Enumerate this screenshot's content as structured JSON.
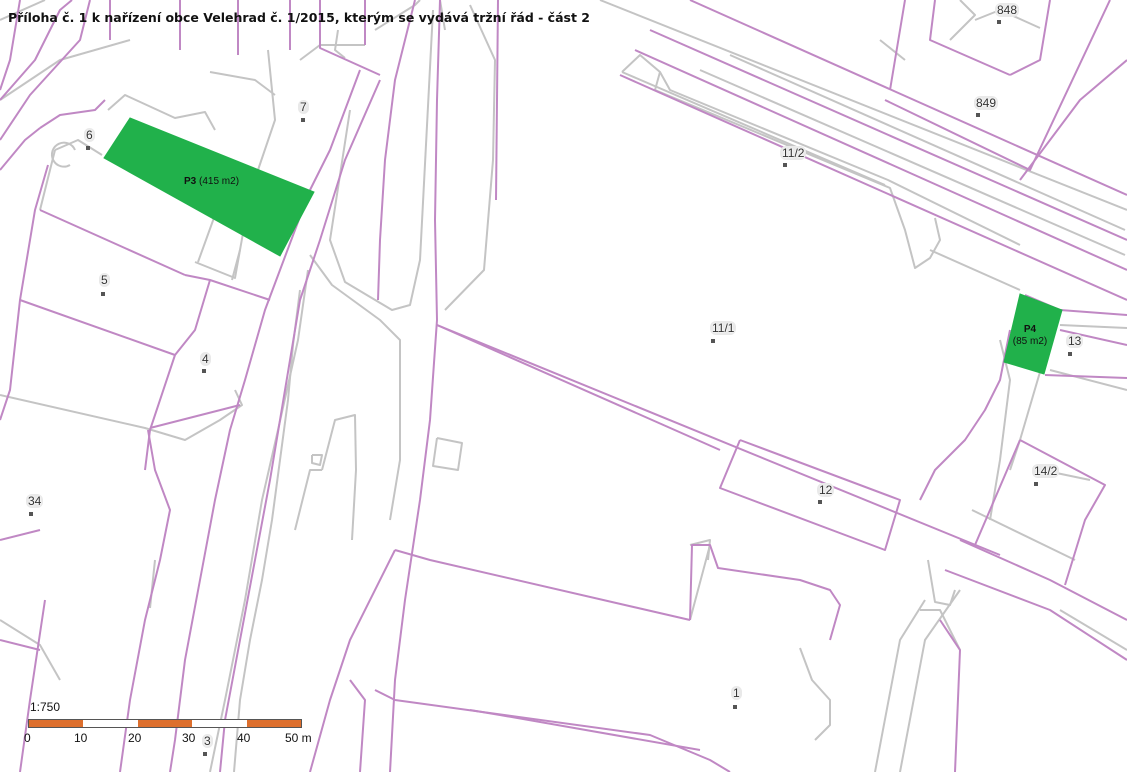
{
  "title": "Příloha č. 1 k nařízení obce Velehrad č. 1/2015, kterým se vydává tržní řád - část 2",
  "zones": {
    "p3": {
      "id": "P3",
      "area": "(415 m2)"
    },
    "p4": {
      "id": "P4",
      "area": "(85 m2)"
    }
  },
  "parcels": {
    "p848": "848",
    "p849": "849",
    "p7": "7",
    "p6": "6",
    "p11_2": "11/2",
    "p5": "5",
    "p11_1": "11/1",
    "p13": "13",
    "p4": "4",
    "p14_2": "14/2",
    "p34": "34",
    "p12": "12",
    "p1": "1",
    "p3": "3"
  },
  "scale": {
    "ratio": "1:750",
    "ticks": [
      "0",
      "10",
      "20",
      "30",
      "40",
      "50 m"
    ]
  },
  "colors": {
    "zone_fill": "#21b14b",
    "cadastral_line": "#c088c4",
    "building_line": "#c4c4c4",
    "scale_orange": "#dd6f2d"
  }
}
